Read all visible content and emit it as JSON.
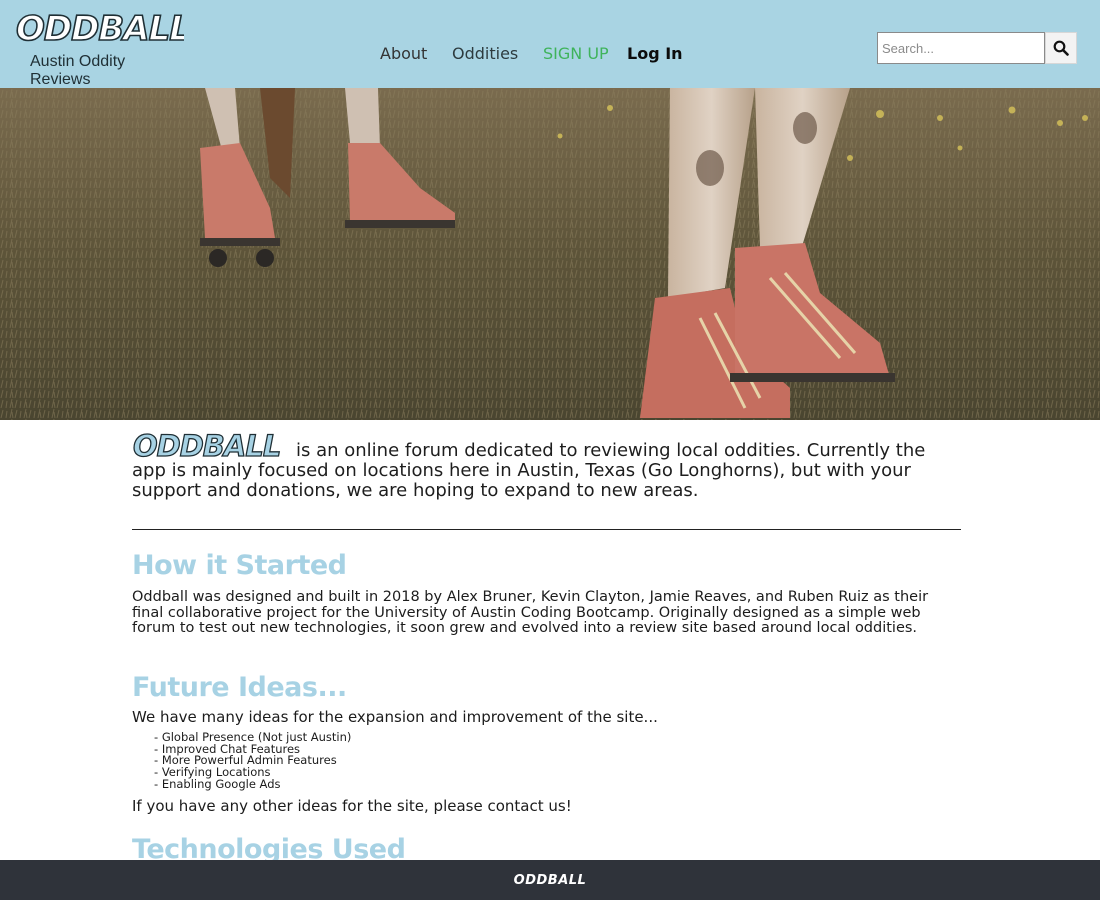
{
  "header": {
    "logo_text": "ODDBALL",
    "tagline": "Austin Oddity Reviews",
    "nav": {
      "about": "About",
      "oddities": "Oddities",
      "signup": "SIGN UP",
      "login": "Log In"
    },
    "search": {
      "placeholder": "Search...",
      "value": "",
      "icon": "search-icon"
    }
  },
  "hero": {
    "image": "roller-skates-on-grass-photo"
  },
  "main": {
    "intro_logo_text": "ODDBALL",
    "intro_text": "is an online forum dedicated to reviewing local oddities. Currently the app is mainly focused on locations here in Austin, Texas (Go Longhorns), but with your support and donations, we are hoping to expand to new areas.",
    "sections": [
      {
        "heading": "How it Started",
        "body": "Oddball was designed and built in 2018 by Alex Bruner, Kevin Clayton, Jamie Reaves, and Ruben Ruiz as their final collaborative project for the University of Austin Coding Bootcamp. Originally designed as a simple web forum to test out new technologies, it soon grew and evolved into a review site based around local oddities."
      },
      {
        "heading": "Future Ideas...",
        "intro": "We have many ideas for the expansion and improvement of the site...",
        "ideas": [
          "Global Presence (Not just Austin)",
          "Improved Chat Features",
          "More Powerful Admin Features",
          "Verifying Locations",
          "Enabling Google Ads"
        ],
        "outro": "If you have any other ideas for the site, please contact us!"
      },
      {
        "heading": "Technologies Used"
      }
    ]
  },
  "footer": {
    "logo_text": "ODDBALL"
  },
  "colors": {
    "header_bg": "#a9d4e3",
    "heading_blue": "#a7d2e4",
    "signup_green": "#3fb35b",
    "footer_bg": "#2f333a"
  }
}
